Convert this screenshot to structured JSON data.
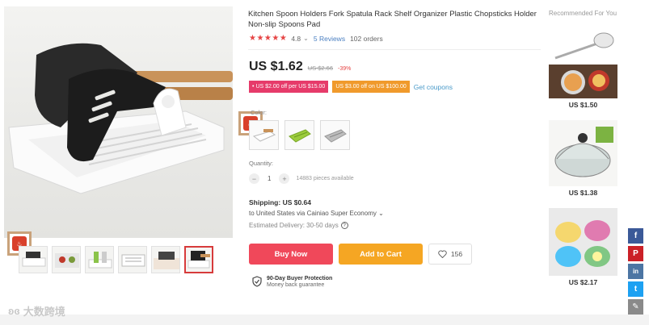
{
  "product": {
    "title": "Kitchen Spoon Holders Fork Spatula Rack Shelf Organizer Plastic Chopsticks Holder Non-slip Spoons Pad",
    "rating": "4.8",
    "reviews": "5 Reviews",
    "orders": "102 orders",
    "price": "US $1.62",
    "old_price": "US $2.66",
    "discount": "-39%"
  },
  "coupons": {
    "coupon1": "US $2.00 off per US $15.00",
    "coupon2": "US $3.00 off on US $100.00",
    "get_coupons": "Get coupons"
  },
  "options": {
    "color_label": "Color:",
    "quantity_label": "Quantity:",
    "quantity_value": "1",
    "pieces_available": "14883 pieces available"
  },
  "shipping": {
    "label": "Shipping:",
    "cost": "US $0.64",
    "via": "to United States via Cainiao Super Economy",
    "delivery": "Estimated Delivery: 30-50 days"
  },
  "actions": {
    "buy_now": "Buy Now",
    "add_to_cart": "Add to Cart",
    "wishlist_count": "156"
  },
  "protection": {
    "title": "90-Day Buyer Protection",
    "subtitle": "Money back guarantee"
  },
  "recommended": {
    "title": "Recommended For You",
    "prices": [
      "US $1.50",
      "US $1.38",
      "US $2.17"
    ]
  },
  "share": [
    "f",
    "P",
    "in",
    "t",
    "✎"
  ],
  "watermark": "大数跨境",
  "colors": {
    "price_red": "#e64545",
    "buy_now": "#f0485a",
    "add_to_cart": "#f5a623",
    "facebook": "#3b5998",
    "pinterest": "#cb2027",
    "vk": "#4c75a3",
    "twitter": "#1da1f2",
    "edit": "#8a8a8a"
  }
}
